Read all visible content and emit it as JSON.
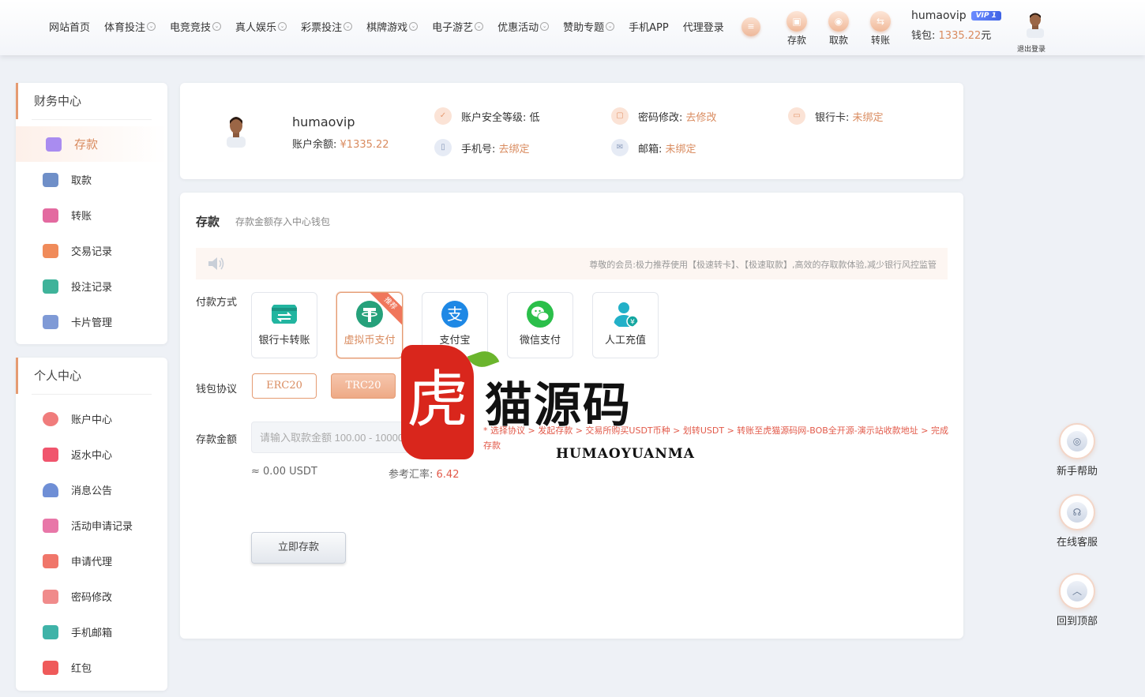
{
  "nav": {
    "items": [
      {
        "label": "网站首页",
        "dropdown": false
      },
      {
        "label": "体育投注",
        "dropdown": true
      },
      {
        "label": "电竞竞技",
        "dropdown": true
      },
      {
        "label": "真人娱乐",
        "dropdown": true
      },
      {
        "label": "彩票投注",
        "dropdown": true
      },
      {
        "label": "棋牌游戏",
        "dropdown": true
      },
      {
        "label": "电子游艺",
        "dropdown": true
      },
      {
        "label": "优惠活动",
        "dropdown": true
      },
      {
        "label": "赞助专题",
        "dropdown": true
      },
      {
        "label": "手机APP",
        "dropdown": false
      },
      {
        "label": "代理登录",
        "dropdown": false
      }
    ],
    "dropdown_glyph": "⌄"
  },
  "quick_actions": {
    "deposit": "存款",
    "withdraw": "取款",
    "transfer": "转账"
  },
  "user": {
    "name": "humaovip",
    "vip": "VIP 1",
    "wallet_label": "钱包:",
    "wallet_amount": "1335.22",
    "wallet_unit": "元",
    "logout": "退出登录"
  },
  "sidebar": {
    "finance_title": "财务中心",
    "finance_items": [
      {
        "label": "存款",
        "icon": "deposit-icon",
        "color": "#a98cf0",
        "active": true
      },
      {
        "label": "取款",
        "icon": "folder-icon",
        "color": "#6f8fc8"
      },
      {
        "label": "转账",
        "icon": "transfer-icon",
        "color": "#e36aa0"
      },
      {
        "label": "交易记录",
        "icon": "record-icon",
        "color": "#f08b5a"
      },
      {
        "label": "投注记录",
        "icon": "bet-record-icon",
        "color": "#3fb39a"
      },
      {
        "label": "卡片管理",
        "icon": "card-icon",
        "color": "#7f9ad6"
      }
    ],
    "personal_title": "个人中心",
    "personal_items": [
      {
        "label": "账户中心",
        "icon": "heart-icon",
        "color": "#f07c7c"
      },
      {
        "label": "返水中心",
        "icon": "gift-icon",
        "color": "#f0556d"
      },
      {
        "label": "消息公告",
        "icon": "bell-icon",
        "color": "#6f8fd6"
      },
      {
        "label": "活动申请记录",
        "icon": "user-card-icon",
        "color": "#e877a8"
      },
      {
        "label": "申请代理",
        "icon": "agent-icon",
        "color": "#f0766a"
      },
      {
        "label": "密码修改",
        "icon": "lock-icon",
        "color": "#f08b8b"
      },
      {
        "label": "手机邮箱",
        "icon": "mail-icon",
        "color": "#3fb3a8"
      },
      {
        "label": "红包",
        "icon": "red-packet-icon",
        "color": "#ef5a5a"
      }
    ]
  },
  "profile": {
    "name": "humaovip",
    "balance_label": "账户余额:",
    "balance": "¥1335.22",
    "security_label": "账户安全等级:",
    "security_value": "低",
    "password_label": "密码修改:",
    "password_link": "去修改",
    "bankcard_label": "银行卡:",
    "bankcard_value": "未绑定",
    "phone_label": "手机号:",
    "phone_link": "去绑定",
    "email_label": "邮箱:",
    "email_value": "未绑定"
  },
  "deposit": {
    "title": "存款",
    "subtitle": "存款金额存入中心钱包",
    "notice": "尊敬的会员:极力推荐使用【极速转卡】、【极速取款】,高效的存取款体验,减少银行风控监管",
    "pay_method_label": "付款方式",
    "methods": [
      {
        "label": "银行卡转账",
        "icon": "bank-transfer-icon",
        "color": "#22b5a0"
      },
      {
        "label": "虚拟币支付",
        "icon": "tether-icon",
        "color": "#26a17b",
        "selected": true,
        "badge": "推荐"
      },
      {
        "label": "支付宝",
        "icon": "alipay-icon",
        "color": "#1e88e5"
      },
      {
        "label": "微信支付",
        "icon": "wechat-icon",
        "color": "#2bbf4a"
      },
      {
        "label": "人工充值",
        "icon": "manual-topup-icon",
        "color": "#22b0c8"
      }
    ],
    "protocol_label": "钱包协议",
    "protocols": [
      {
        "label": "ERC20",
        "selected": false
      },
      {
        "label": "TRC20",
        "selected": true
      }
    ],
    "amount_label": "存款金额",
    "amount_placeholder": "请输入取款金额 100.00 - 1000000.00",
    "hint": "* 选择协议 > 发起存款 > 交易所购买USDT币种 > 划转USDT > 转账至虎猫源码网-BOB全开源-演示站收款地址 > 完成存款",
    "usdt": "≈ 0.00 USDT",
    "rate_label": "参考汇率:",
    "rate_value": "6.42",
    "submit": "立即存款"
  },
  "float": {
    "help": "新手帮助",
    "service": "在线客服",
    "top": "回到顶部"
  },
  "watermark": {
    "seal": "虎",
    "text": "猫源码",
    "sub": "HUMAOYUANMA"
  },
  "colors": {
    "accent": "#d98b5f",
    "warn": "#e25a4a"
  }
}
